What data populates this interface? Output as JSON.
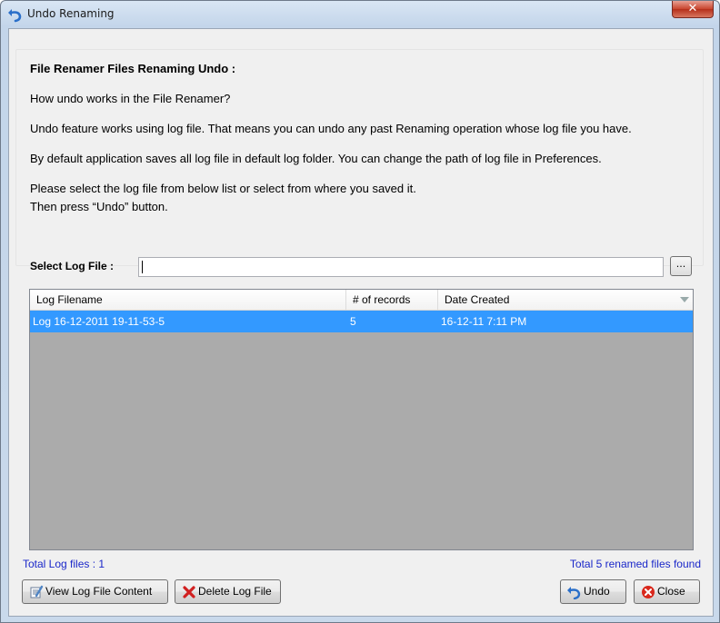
{
  "window": {
    "title": "Undo Renaming",
    "close_glyph": "✕"
  },
  "info": {
    "heading": "File Renamer Files Renaming Undo :",
    "question": "How undo works in the File Renamer?",
    "para1": "Undo feature works using log file. That means you can undo any past Renaming operation whose log file you have.",
    "para2": "By default application saves all log file in default log folder. You can change the path of log file in Preferences.",
    "para3_line1": "Please select the log file from below list or select from where you saved it.",
    "para3_line2": "Then press “Undo” button."
  },
  "select": {
    "label": "Select Log File :",
    "value": "",
    "browse_label": "..."
  },
  "list": {
    "columns": [
      "Log Filename",
      "# of records",
      "Date Created"
    ],
    "rows": [
      {
        "filename": "Log 16-12-2011 19-11-53-5",
        "records": "5",
        "date": "16-12-11 7:11 PM",
        "selected": true
      }
    ]
  },
  "status": {
    "total_logs": "Total Log files : 1",
    "renamed": "Total 5 renamed files found"
  },
  "buttons": {
    "view": "View Log File Content",
    "delete": "Delete Log File",
    "undo": "Undo",
    "close": "Close"
  },
  "colors": {
    "selection": "#3399ff",
    "status_text": "#1a27c9",
    "list_bg": "#ababab"
  }
}
